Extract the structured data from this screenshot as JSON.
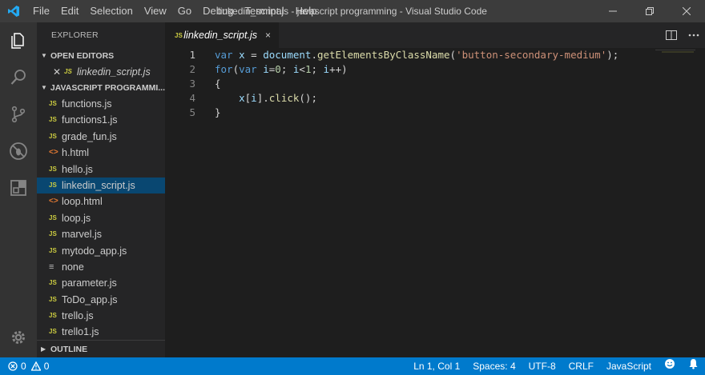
{
  "titlebar": {
    "menu": [
      "File",
      "Edit",
      "Selection",
      "View",
      "Go",
      "Debug",
      "Terminal",
      "Help"
    ],
    "window_title": "linkedin_script.js - javascript programming - Visual Studio Code"
  },
  "activitybar": {
    "icons": [
      "explorer-icon",
      "search-icon",
      "source-control-icon",
      "debug-icon",
      "extensions-icon",
      "settings-gear-icon"
    ]
  },
  "sidebar": {
    "title": "EXPLORER",
    "open_editors": {
      "header": "OPEN EDITORS",
      "items": [
        {
          "badge": "JS",
          "label": "linkedin_script.js"
        }
      ]
    },
    "folder": {
      "header": "JAVASCRIPT PROGRAMMI...",
      "files": [
        {
          "badge": "JS",
          "label": "functions.js"
        },
        {
          "badge": "JS",
          "label": "functions1.js"
        },
        {
          "badge": "JS",
          "label": "grade_fun.js"
        },
        {
          "badge": "<>",
          "label": "h.html"
        },
        {
          "badge": "JS",
          "label": "hello.js"
        },
        {
          "badge": "JS",
          "label": "linkedin_script.js"
        },
        {
          "badge": "<>",
          "label": "loop.html"
        },
        {
          "badge": "JS",
          "label": "loop.js"
        },
        {
          "badge": "JS",
          "label": "marvel.js"
        },
        {
          "badge": "JS",
          "label": "mytodo_app.js"
        },
        {
          "badge": "≡",
          "label": "none"
        },
        {
          "badge": "JS",
          "label": "parameter.js"
        },
        {
          "badge": "JS",
          "label": "ToDo_app.js"
        },
        {
          "badge": "JS",
          "label": "trello.js"
        },
        {
          "badge": "JS",
          "label": "trello1.js"
        }
      ]
    },
    "outline_header": "OUTLINE"
  },
  "editor": {
    "tab": {
      "badge": "JS",
      "label": "linkedin_script.js",
      "close": "×"
    },
    "line_numbers": [
      "1",
      "2",
      "3",
      "4",
      "5"
    ],
    "code": [
      [
        {
          "t": "var",
          "c": "kw"
        },
        {
          "t": " "
        },
        {
          "t": "x",
          "c": "var"
        },
        {
          "t": " = "
        },
        {
          "t": "document",
          "c": "var"
        },
        {
          "t": "."
        },
        {
          "t": "getElementsByClassName",
          "c": "fn"
        },
        {
          "t": "("
        },
        {
          "t": "'button-secondary-medium'",
          "c": "str"
        },
        {
          "t": ");"
        }
      ],
      [
        {
          "t": "for",
          "c": "kw"
        },
        {
          "t": "("
        },
        {
          "t": "var",
          "c": "kw"
        },
        {
          "t": " "
        },
        {
          "t": "i",
          "c": "var"
        },
        {
          "t": "="
        },
        {
          "t": "0",
          "c": "num"
        },
        {
          "t": "; "
        },
        {
          "t": "i",
          "c": "var"
        },
        {
          "t": "<"
        },
        {
          "t": "1",
          "c": "num"
        },
        {
          "t": "; "
        },
        {
          "t": "i",
          "c": "var"
        },
        {
          "t": "++)"
        }
      ],
      [
        {
          "t": "{"
        }
      ],
      [
        {
          "t": "    "
        },
        {
          "t": "x",
          "c": "var"
        },
        {
          "t": "["
        },
        {
          "t": "i",
          "c": "var"
        },
        {
          "t": "]."
        },
        {
          "t": "click",
          "c": "fn"
        },
        {
          "t": "();"
        }
      ],
      [
        {
          "t": "}"
        }
      ]
    ]
  },
  "statusbar": {
    "errors": "0",
    "warnings": "0",
    "position": "Ln 1, Col 1",
    "spaces": "Spaces: 4",
    "encoding": "UTF-8",
    "eol": "CRLF",
    "language": "JavaScript"
  },
  "colors": {
    "statusbar": "#007acc",
    "activitybar": "#333333",
    "sidebar": "#252526",
    "editor": "#1e1e1e",
    "selection": "#094771"
  }
}
